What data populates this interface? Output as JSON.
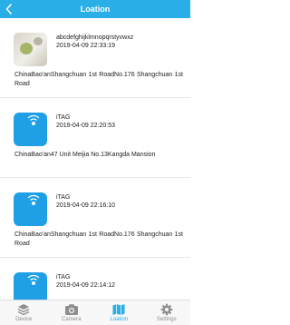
{
  "nav": {
    "title": "Loation",
    "back_icon": "chevron-left-icon"
  },
  "colors": {
    "accent": "#29aee8",
    "device_tile": "#1e9fe6",
    "tab_inactive": "#8e8e8e"
  },
  "records": [
    {
      "thumb": "photo",
      "name": "abcdefghijklmnopqrstyvwxz",
      "time": "2019-04-09  22:33:19",
      "address": "ChinaBao'anShangchuan 1st RoadNo.176 Shangchuan 1st Road"
    },
    {
      "thumb": "device",
      "name": "iTAG",
      "time": "2019-04-09  22:20:53",
      "address": "ChinaBao'an47 Unit Meijia No.13Kangda Mansion"
    },
    {
      "thumb": "device",
      "name": "iTAG",
      "time": "2019-04-09  22:16:10",
      "address": "ChinaBao'anShangchuan 1st RoadNo.176 Shangchuan 1st Road"
    },
    {
      "thumb": "device",
      "name": "iTAG",
      "time": "2019-04-09  22:14:12",
      "address": ""
    }
  ],
  "tabs": [
    {
      "label": "Device",
      "icon": "device-stack-icon",
      "active": false
    },
    {
      "label": "Camera",
      "icon": "camera-icon",
      "active": false
    },
    {
      "label": "Loation",
      "icon": "map-icon",
      "active": true
    },
    {
      "label": "Settings",
      "icon": "gear-icon",
      "active": false
    }
  ]
}
